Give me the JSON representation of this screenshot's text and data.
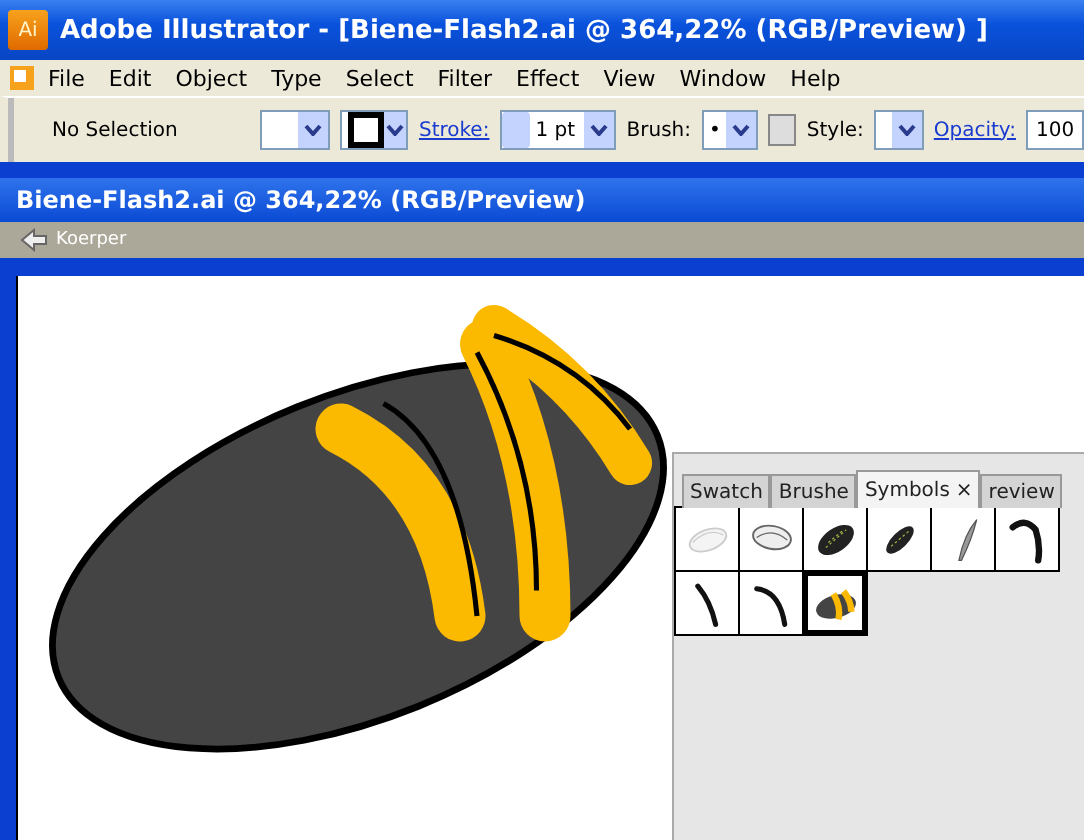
{
  "window": {
    "title": "Adobe Illustrator - [Biene-Flash2.ai @ 364,22% (RGB/Preview) ]",
    "app_icon": "Ai"
  },
  "menu": [
    "File",
    "Edit",
    "Object",
    "Type",
    "Select",
    "Filter",
    "Effect",
    "View",
    "Window",
    "Help"
  ],
  "control_bar": {
    "selection": "No Selection",
    "stroke_label": "Stroke:",
    "stroke_weight": "1 pt",
    "brush_label": "Brush:",
    "brush_value": "•",
    "style_label": "Style:",
    "opacity_label": "Opacity:",
    "opacity_value": "100"
  },
  "document": {
    "title": "Biene-Flash2.ai @ 364,22% (RGB/Preview)",
    "breadcrumb": "Koerper"
  },
  "panel": {
    "tabs": [
      {
        "label": "Swatch",
        "selected": false
      },
      {
        "label": "Brushe",
        "selected": false
      },
      {
        "label": "Symbols",
        "selected": true,
        "close": "×"
      },
      {
        "label": "review",
        "selected": false
      }
    ],
    "symbols": [
      {
        "kind": "outline-faint",
        "selected": false
      },
      {
        "kind": "outline",
        "selected": false
      },
      {
        "kind": "striped",
        "selected": false
      },
      {
        "kind": "striped-slim",
        "selected": false
      },
      {
        "kind": "blade",
        "selected": false
      },
      {
        "kind": "hook",
        "selected": false
      },
      {
        "kind": "leg",
        "selected": false
      },
      {
        "kind": "leg-curved",
        "selected": false
      },
      {
        "kind": "bee",
        "selected": true
      }
    ]
  }
}
